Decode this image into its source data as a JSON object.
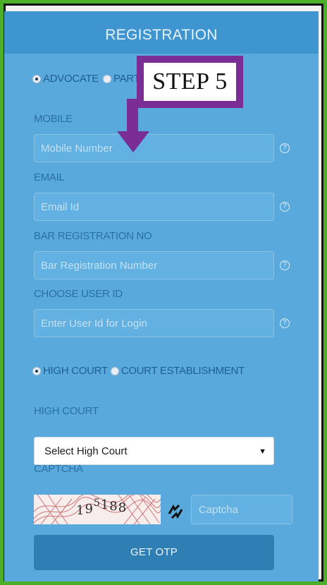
{
  "header": {
    "title": "REGISTRATION"
  },
  "user_type": {
    "options": [
      "ADVOCATE",
      "PARTY IN PERSON"
    ],
    "selected": "ADVOCATE"
  },
  "annotation": {
    "text": "STEP 5",
    "color": "#7a2d94"
  },
  "fields": {
    "mobile": {
      "label": "MOBILE",
      "placeholder": "Mobile Number"
    },
    "email": {
      "label": "EMAIL",
      "placeholder": "Email Id"
    },
    "bar_no": {
      "label": "BAR REGISTRATION NO",
      "placeholder": "Bar Registration Number"
    },
    "user_id": {
      "label": "CHOOSE USER ID",
      "placeholder": "Enter User Id for Login"
    }
  },
  "help_icon": "?",
  "court_type": {
    "options": [
      "HIGH COURT",
      "COURT ESTABLISHMENT"
    ],
    "selected": "HIGH COURT"
  },
  "high_court": {
    "label": "HIGH COURT",
    "selected": "Select High Court"
  },
  "captcha": {
    "label": "CAPTCHA",
    "image_text": "195188",
    "placeholder": "Captcha"
  },
  "submit": {
    "label": "GET OTP"
  },
  "colors": {
    "panel": "#5aa9dc",
    "header": "#3f95cf",
    "button": "#2f7fb5",
    "frame": "#4caf2a"
  }
}
